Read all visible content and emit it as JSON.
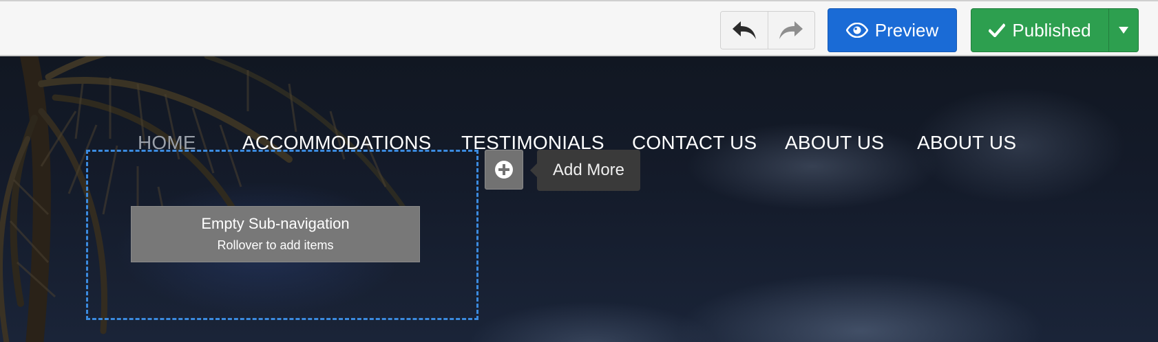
{
  "toolbar": {
    "undo_icon": "undo-arrow-icon",
    "redo_icon": "redo-arrow-icon",
    "preview_label": "Preview",
    "preview_icon": "eye-icon",
    "published_label": "Published",
    "published_icon": "checkmark-icon",
    "dropdown_icon": "caret-down-icon",
    "colors": {
      "preview": "#1a6bd6",
      "published": "#2d9f4f",
      "toolbar_bg": "#f6f6f6"
    }
  },
  "nav": {
    "items": [
      {
        "label": "HOME"
      },
      {
        "label": "ACCOMMODATIONS"
      },
      {
        "label": "TESTIMONIALS"
      },
      {
        "label": "CONTACT US"
      },
      {
        "label": "ABOUT US"
      },
      {
        "label": "ABOUT US"
      }
    ]
  },
  "subnav": {
    "title": "Empty Sub-navigation",
    "hint": "Rollover to add items",
    "border_color": "#3b8be0"
  },
  "add_more": {
    "icon": "plus-circle-icon",
    "tooltip": "Add More"
  }
}
